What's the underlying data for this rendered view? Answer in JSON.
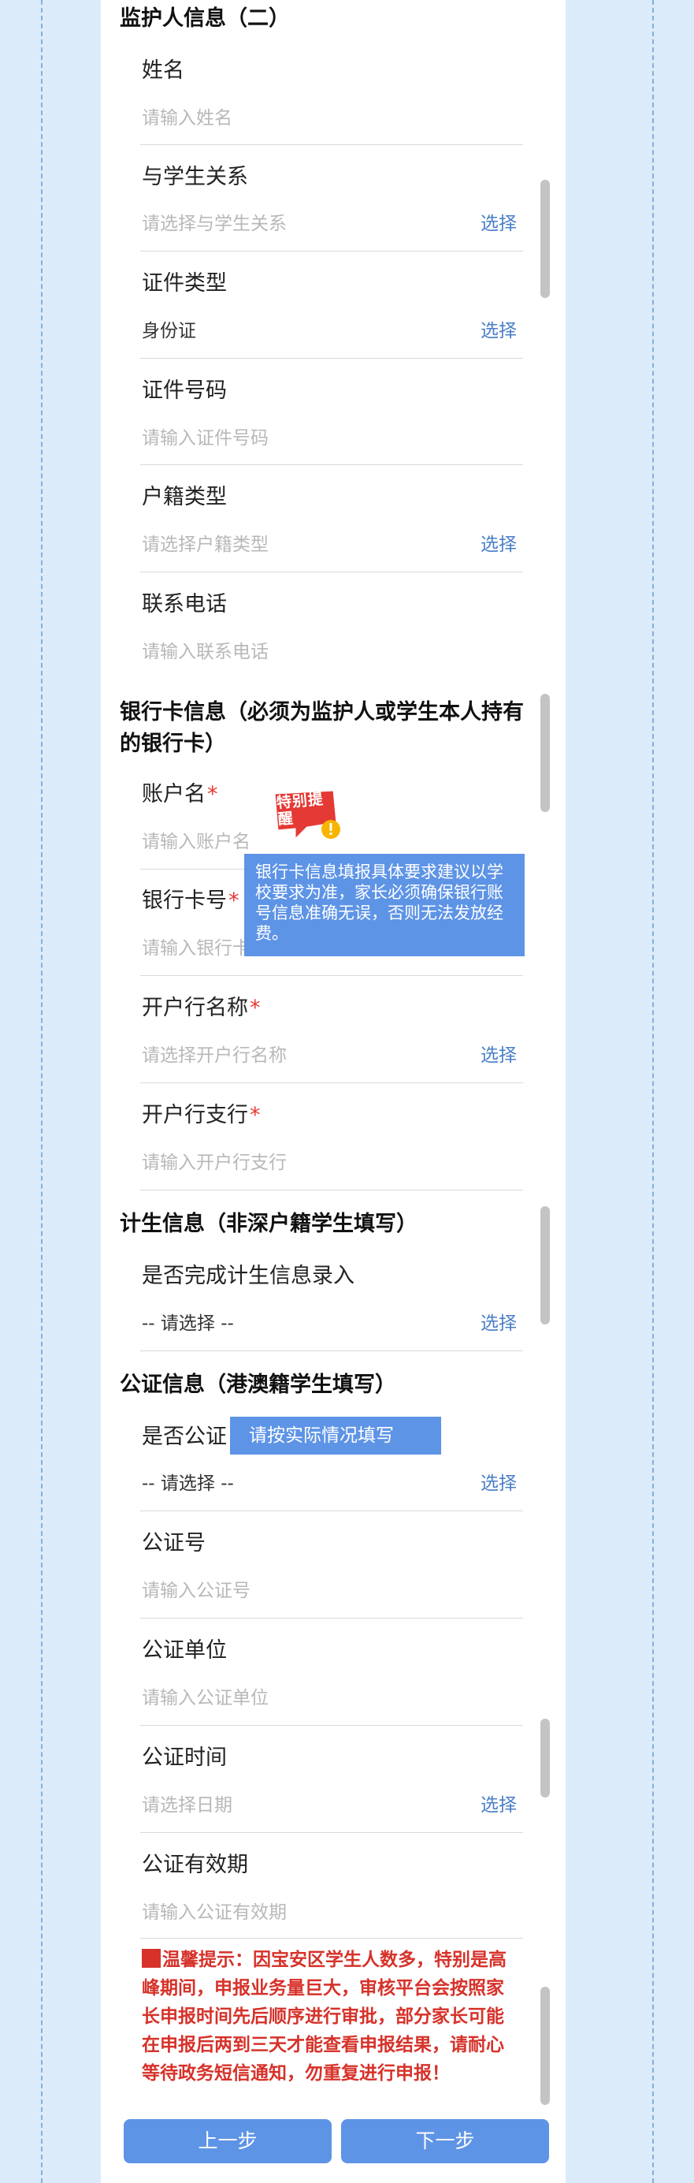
{
  "section_guardian2": {
    "title": "监护人信息（二）"
  },
  "guardian2_fields": [
    {
      "label": "姓名",
      "value": "请输入姓名",
      "placeholder": true,
      "select": ""
    },
    {
      "label": "与学生关系",
      "value": "请选择与学生关系",
      "placeholder": true,
      "select": "选择"
    },
    {
      "label": "证件类型",
      "value": "身份证",
      "placeholder": false,
      "select": "选择"
    },
    {
      "label": "证件号码",
      "value": "请输入证件号码",
      "placeholder": true,
      "select": ""
    },
    {
      "label": "户籍类型",
      "value": "请选择户籍类型",
      "placeholder": true,
      "select": "选择"
    },
    {
      "label": "联系电话",
      "value": "请输入联系电话",
      "placeholder": true,
      "select": ""
    }
  ],
  "section_bank": {
    "title_line1": "银行卡信息（必须为监护人或学生本人持有",
    "title_line2": "的银行卡）"
  },
  "bank_fields": [
    {
      "label": "账户名",
      "required": "*",
      "value": "请输入账户名",
      "select": ""
    },
    {
      "label": "银行卡号",
      "required": "*",
      "value": "请输入银行卡号",
      "select": ""
    },
    {
      "label": "开户行名称",
      "required": "*",
      "value": "请选择开户行名称",
      "select": "选择"
    },
    {
      "label": "开户行支行",
      "required": "*",
      "value": "请输入开户行支行",
      "select": ""
    }
  ],
  "section_family_planning": {
    "title": "计生信息（非深户籍学生填写）"
  },
  "family_planning_field": {
    "label": "是否完成计生信息录入",
    "value": "-- 请选择 --",
    "select": "选择"
  },
  "section_notary": {
    "title": "公证信息（港澳籍学生填写）"
  },
  "notary_fields": [
    {
      "label": "是否公证",
      "value": "-- 请选择 --",
      "placeholder": false,
      "select": "选择"
    },
    {
      "label": "公证号",
      "value": "请输入公证号",
      "placeholder": true,
      "select": ""
    },
    {
      "label": "公证单位",
      "value": "请输入公证单位",
      "placeholder": true,
      "select": ""
    },
    {
      "label": "公证时间",
      "value": "请选择日期",
      "placeholder": true,
      "select": "选择"
    },
    {
      "label": "公证有效期",
      "value": "请输入公证有效期",
      "placeholder": true,
      "select": ""
    }
  ],
  "warm_tip": "温馨提示：因宝安区学生人数多，特别是高峰期间，申报业务量巨大，审核平台会按照家长申报时间先后顺序进行审批，部分家长可能在申报后两到三天才能查看申报结果，请耐心等待政务短信通知，勿重复进行申报！",
  "buttons": {
    "prev": "上一步",
    "next": "下一步"
  },
  "overlays": {
    "special_reminder_stamp": "特别提醒",
    "bank_note": "银行卡信息填报具体要求建议以学校要求为准，家长必须确保银行账号信息准确无误，否则无法发放经费。",
    "notary_note": "请按实际情况填写"
  },
  "colors": {
    "page_bg": "#dcebfa",
    "card_bg": "#ffffff",
    "accent": "#5e94e6",
    "link": "#4a7fc8",
    "required": "#e53935",
    "tip_red": "#d6322a",
    "placeholder": "#b8b8b8"
  }
}
